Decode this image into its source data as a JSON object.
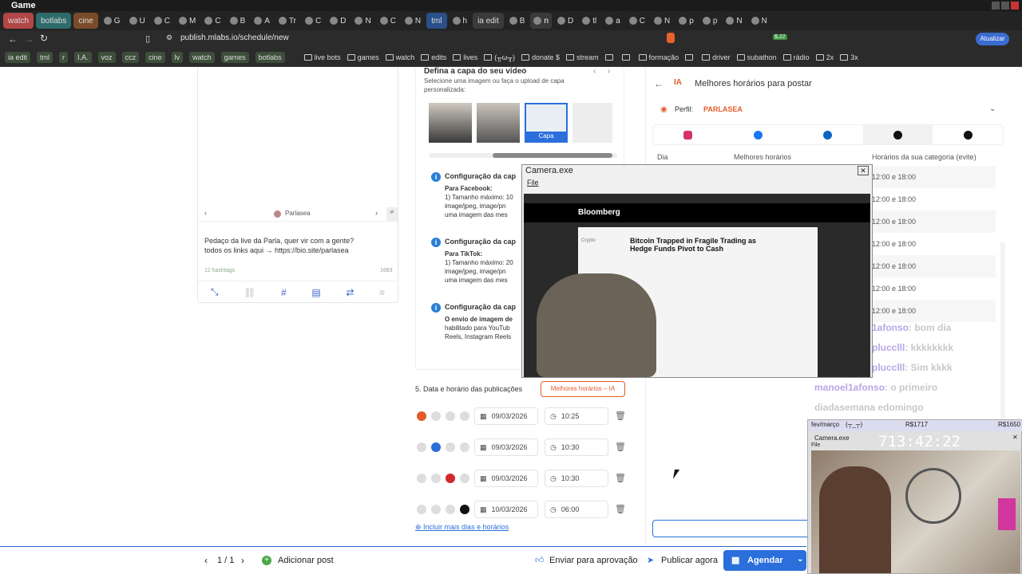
{
  "window": {
    "title": "Game"
  },
  "tabs": [
    {
      "label": "watch",
      "color": "#b24646",
      "named": true
    },
    {
      "label": "botlabs",
      "color": "#2e6b6b",
      "named": true
    },
    {
      "label": "cine",
      "color": "#7a4b2a",
      "named": true
    },
    {
      "label": "G",
      "color": "#3a3a3a"
    },
    {
      "label": "U",
      "color": "#3a3a3a"
    },
    {
      "label": "C",
      "color": "#3a3a3a"
    },
    {
      "label": "M",
      "color": "#3a3a3a"
    },
    {
      "label": "C",
      "color": "#3a3a3a"
    },
    {
      "label": "B",
      "color": "#3a3a3a"
    },
    {
      "label": "A",
      "color": "#3a3a3a"
    },
    {
      "label": "Tr",
      "color": "#3a3a3a"
    },
    {
      "label": "C",
      "color": "#3a3a3a"
    },
    {
      "label": "D",
      "color": "#3a3a3a"
    },
    {
      "label": "N",
      "color": "#3a3a3a"
    },
    {
      "label": "C",
      "color": "#3a3a3a"
    },
    {
      "label": "N",
      "color": "#3a3a3a"
    },
    {
      "label": "tml",
      "color": "#2a4f8a",
      "named": true
    },
    {
      "label": "h",
      "color": "#3a3a3a"
    },
    {
      "label": "ia edit",
      "color": "#3a3a3a",
      "named": true
    },
    {
      "label": "B",
      "color": "#3a3a3a"
    },
    {
      "label": "n",
      "color": "#3a3a3a",
      "active": true
    },
    {
      "label": "D",
      "color": "#3a3a3a"
    },
    {
      "label": "tl",
      "color": "#3a3a3a"
    },
    {
      "label": "a",
      "color": "#3a3a3a"
    },
    {
      "label": "C",
      "color": "#3a3a3a"
    },
    {
      "label": "N",
      "color": "#3a3a3a"
    },
    {
      "label": "p",
      "color": "#3a3a3a"
    },
    {
      "label": "p",
      "color": "#3a3a3a"
    },
    {
      "label": "N",
      "color": "#3a3a3a"
    },
    {
      "label": "N",
      "color": "#3a3a3a"
    }
  ],
  "address": {
    "url": "publish.mlabs.io/schedule/new",
    "badge": "$,22",
    "update": "Atualizar"
  },
  "bookmarks": [
    "ia edit",
    "tml",
    "r",
    "I.A.",
    "voz",
    "ccz",
    "cine",
    "lv",
    "watch",
    "games",
    "botlabs",
    "",
    "",
    "live bots",
    "games",
    "watch",
    "edits",
    "lives",
    "(╥ω╥)",
    "donate $",
    "stream",
    "",
    "",
    "formação",
    "",
    "driver",
    "subathon",
    "rádio",
    "2x",
    "3x"
  ],
  "post_card": {
    "name": "Parlasea",
    "text_line1": "Pedaço da live da Parla, quer vir com a gente?",
    "text_line2": "todos os links aqui → https://bio.site/parlasea",
    "hashtags": "12 hashtags",
    "count": "1683"
  },
  "cover": {
    "title": "Defina a capa do seu vídeo",
    "subtitle": "Selecione uma imagem ou faça o upload de capa personalizada:",
    "cap_label": "Capa"
  },
  "info": [
    {
      "title": "Configuração da cap",
      "network": "Para Facebook:",
      "l1": "1) Tamanho máximo: 10",
      "l2": "image/jpeg, image/pn",
      "l3": "uma imagem das mes"
    },
    {
      "title": "Configuração da cap",
      "network": "Para TikTok:",
      "l1": "1) Tamanho máximo: 20",
      "l2": "image/jpeg, image/pn",
      "l3": "uma imagem das mes"
    },
    {
      "title": "Configuração da cap",
      "network": "O envio de imagem de",
      "l1": "habilitado para YouTub",
      "l2": "Reels, Instagram Reels",
      "l3": ""
    }
  ],
  "schedule": {
    "title": "5. Data e horário das publicações",
    "ai_button": "Melhores horários – IA",
    "more": "Incluir mais dias e horários",
    "rows": [
      {
        "date": "09/03/2026",
        "time": "10:25"
      },
      {
        "date": "09/03/2026",
        "time": "10:30"
      },
      {
        "date": "09/03/2026",
        "time": "10:30"
      },
      {
        "date": "10/03/2026",
        "time": "06:00"
      }
    ]
  },
  "best": {
    "title": "Melhores horários para postar",
    "profile_label": "Perfil:",
    "profile": "PARLASEA",
    "col_day": "Dia",
    "col_best": "Melhores horários",
    "col_cat": "Horários da sua categoria (evite)",
    "cat_rows": [
      "12:00 e 18:00",
      "12:00 e 18:00",
      "12:00 e 18:00",
      "12:00 e 18:00",
      "12:00 e 18:00",
      "12:00 e 18:00",
      "12:00 e 18:00"
    ]
  },
  "camera1": {
    "title": "Camera.exe",
    "menu": "File",
    "headline": "Bitcoin Trapped in Fragile Trading as Hedge Funds Pivot to Cash",
    "brand": "Bloomberg",
    "crypto": "Crypto"
  },
  "chat": [
    {
      "user": "1afonso",
      "msg": ": bom dia"
    },
    {
      "user": "plucclll",
      "msg": ": kkkkkkkk"
    },
    {
      "user": "plucclll",
      "msg": ": Sim kkkk"
    },
    {
      "user": "manoel1afonso",
      "msg": ": o primeiro"
    },
    {
      "user": "",
      "msg": "diadasemana edomingo"
    }
  ],
  "overlay": {
    "goal": "fev/março",
    "face": "(┬_┬)",
    "r1": "R$1717",
    "r2": "R$1650",
    "timer": "713:42:22",
    "title": "Camera.exe",
    "menu": "File"
  },
  "footer": {
    "page": "1 / 1",
    "add": "Adicionar post",
    "approve": "Enviar para aprovação",
    "publish": "Publicar agora",
    "schedule": "Agendar"
  }
}
